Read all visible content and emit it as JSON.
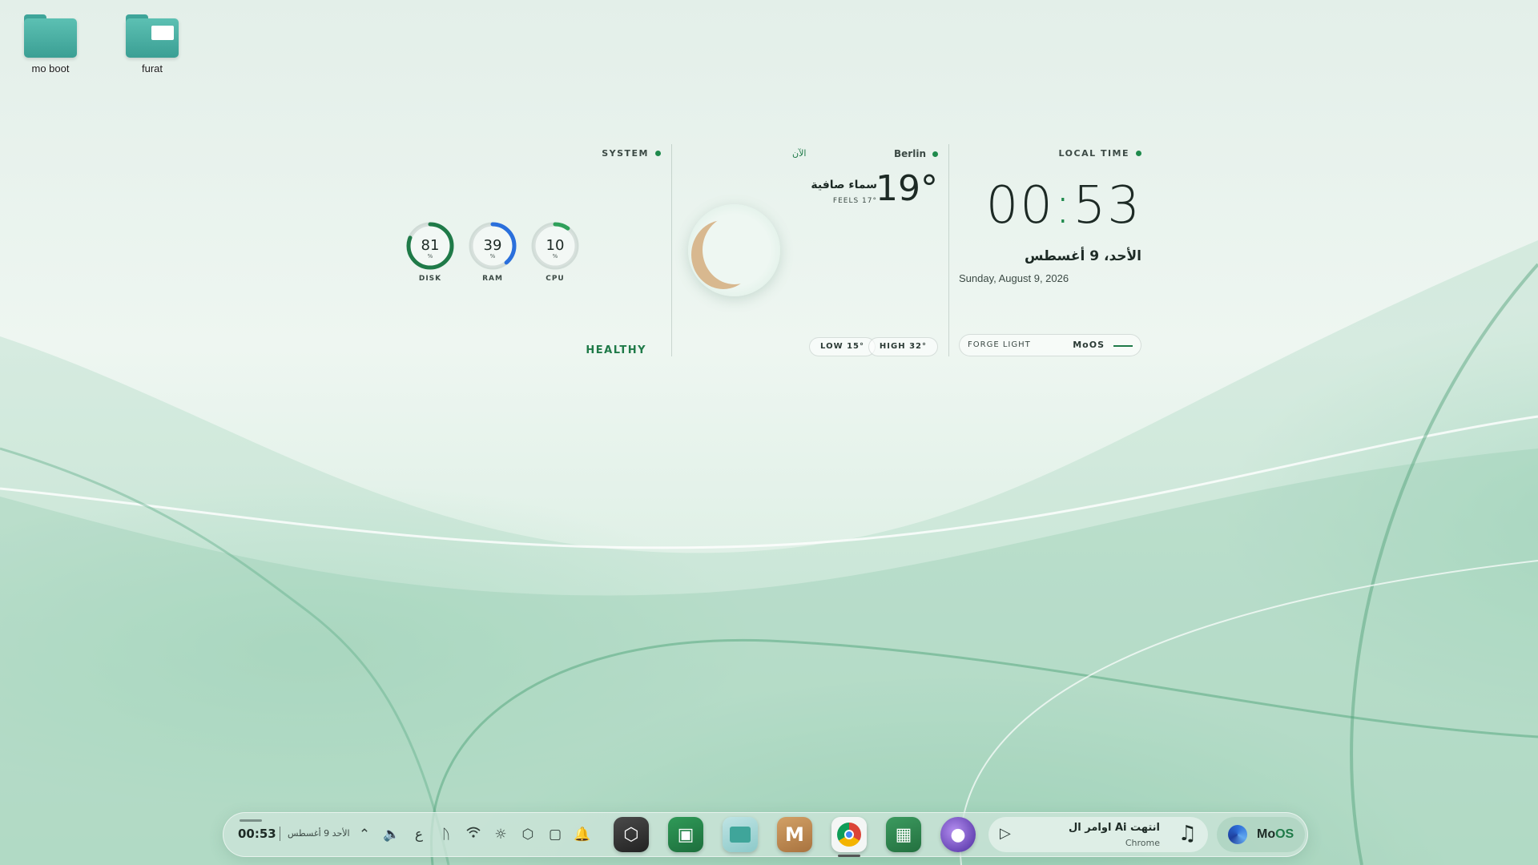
{
  "desktop": {
    "icons": [
      {
        "label": "mo boot"
      },
      {
        "label": "furat"
      }
    ]
  },
  "system": {
    "title": "SYSTEM",
    "gauges": [
      {
        "label": "DISK",
        "value": "81",
        "unit": "%",
        "percent": 81,
        "color": "#1f7a48"
      },
      {
        "label": "RAM",
        "value": "39",
        "unit": "%",
        "percent": 39,
        "color": "#2a6fdc"
      },
      {
        "label": "CPU",
        "value": "10",
        "unit": "%",
        "percent": 10,
        "color": "#2fa05a"
      }
    ],
    "status": "HEALTHY"
  },
  "weather": {
    "now_label": "الآن",
    "city": "Berlin",
    "temp": "19°",
    "condition": "سماء صافية",
    "feels": "FEELS 17°",
    "low": "LOW 15°",
    "high": "HIGH 32°",
    "icon": "moon-icon"
  },
  "time": {
    "title": "LOCAL TIME",
    "hours": "00",
    "minutes": "53",
    "date_arabic": "الأحد، 9 أغسطس",
    "date": "Sunday, August 9, 2026",
    "theme_label": "FORGE LIGHT",
    "brand": "MoOS"
  },
  "taskbar": {
    "time": "00:53",
    "date": "الأحد 9 أغسطس",
    "tray": [
      "chevron-up-icon",
      "audio-icon",
      "language-icon",
      "bluetooth-icon",
      "wifi-icon",
      "brightness-icon",
      "cube-icon",
      "screen-icon",
      "bell-icon"
    ],
    "lang_glyph": "ع",
    "apps": [
      "cube-app-icon",
      "devices-app-icon",
      "files-app-icon",
      "m-app-icon",
      "chrome-icon",
      "apps-grid-icon",
      "cat-app-icon"
    ],
    "media": {
      "title": "اوامر ال Ai انتهت",
      "source": "Chrome"
    },
    "brand": {
      "mo": "Mo",
      "os": "OS"
    }
  }
}
